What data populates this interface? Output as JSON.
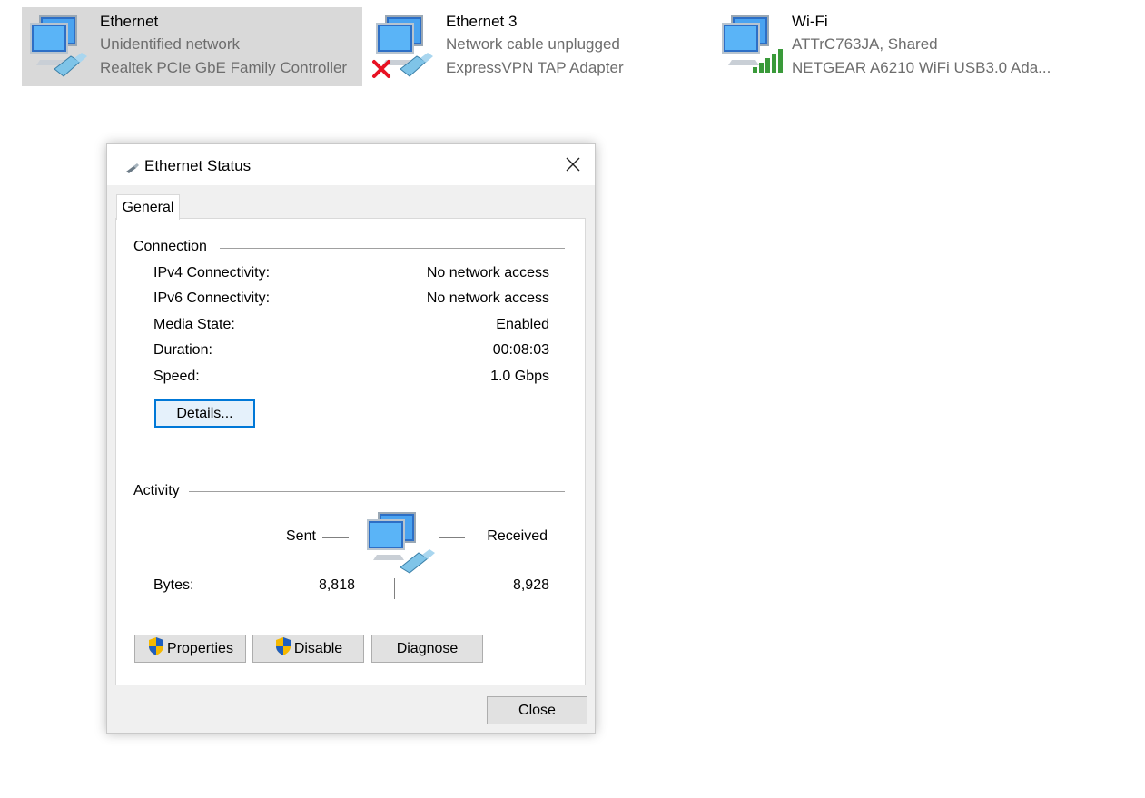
{
  "adapters": [
    {
      "name": "Ethernet",
      "status": "Unidentified network",
      "device": "Realtek PCIe GbE Family Controller",
      "selected": true
    },
    {
      "name": "Ethernet 3",
      "status": "Network cable unplugged",
      "device": "ExpressVPN TAP Adapter",
      "selected": false
    },
    {
      "name": "Wi-Fi",
      "status": "ATTrC763JA, Shared",
      "device": "NETGEAR A6210 WiFi USB3.0 Ada...",
      "selected": false
    }
  ],
  "dialog": {
    "title": "Ethernet Status",
    "tab": "General",
    "connection": {
      "heading": "Connection",
      "rows": [
        {
          "label": "IPv4 Connectivity:",
          "value": "No network access"
        },
        {
          "label": "IPv6 Connectivity:",
          "value": "No network access"
        },
        {
          "label": "Media State:",
          "value": "Enabled"
        },
        {
          "label": "Duration:",
          "value": "00:08:03"
        },
        {
          "label": "Speed:",
          "value": "1.0 Gbps"
        }
      ],
      "details_button": "Details..."
    },
    "activity": {
      "heading": "Activity",
      "sent_label": "Sent",
      "received_label": "Received",
      "bytes_label": "Bytes:",
      "bytes_sent": "8,818",
      "bytes_received": "8,928"
    },
    "buttons": {
      "properties": "Properties",
      "disable": "Disable",
      "diagnose": "Diagnose",
      "close": "Close"
    }
  },
  "colors": {
    "accent": "#0078d7",
    "selected_bg": "#d9d9d9",
    "error_red": "#e81123",
    "signal_green": "#3a9a3a"
  }
}
